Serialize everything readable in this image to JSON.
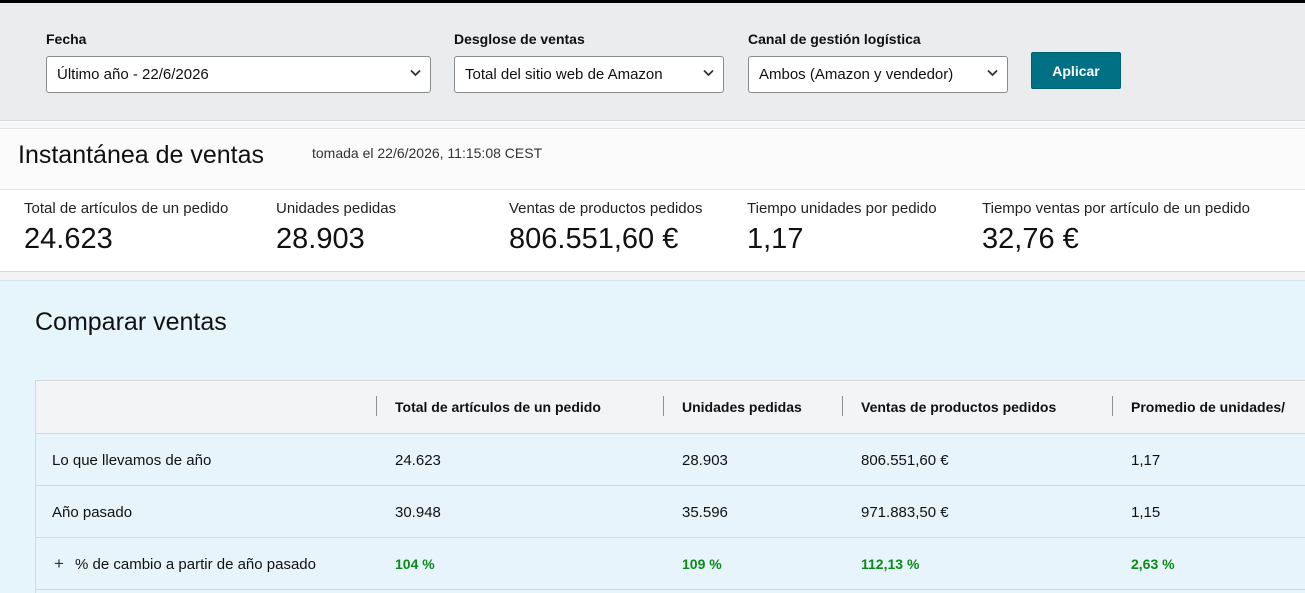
{
  "filters": {
    "date_label": "Fecha",
    "date_value": "Último año - 22/6/2026",
    "breakdown_label": "Desglose de ventas",
    "breakdown_value": "Total del sitio web de Amazon",
    "channel_label": "Canal de gestión logística",
    "channel_value": "Ambos (Amazon y vendedor)",
    "apply_label": "Aplicar"
  },
  "snapshot": {
    "title": "Instantánea de ventas",
    "taken": "tomada el 22/6/2026, 11:15:08 CEST",
    "metrics": [
      {
        "label": "Total de artículos de un pedido",
        "value": "24.623"
      },
      {
        "label": "Unidades pedidas",
        "value": "28.903"
      },
      {
        "label": "Ventas de productos pedidos",
        "value": "806.551,60 €"
      },
      {
        "label": "Tiempo unidades por pedido",
        "value": "1,17"
      },
      {
        "label": "Tiempo ventas por artículo de un pedido",
        "value": "32,76 €"
      }
    ]
  },
  "compare": {
    "title": "Comparar ventas",
    "columns": [
      "Total de artículos de un pedido",
      "Unidades pedidas",
      "Ventas de productos pedidos",
      "Promedio de unidades/"
    ],
    "rows": [
      {
        "label": "Lo que llevamos de año",
        "cells": [
          "24.623",
          "28.903",
          "806.551,60 €",
          "1,17"
        ]
      },
      {
        "label": "Año pasado",
        "cells": [
          "30.948",
          "35.596",
          "971.883,50 €",
          "1,15"
        ]
      },
      {
        "label": "% de cambio a partir de año pasado",
        "expand": "+",
        "cells": [
          "104 %",
          "109 %",
          "112,13 %",
          "2,63 %"
        ]
      }
    ]
  },
  "colors": {
    "accent": "#007185",
    "positive": "#0b8a1a",
    "compare_bg": "#e6f4fc"
  }
}
